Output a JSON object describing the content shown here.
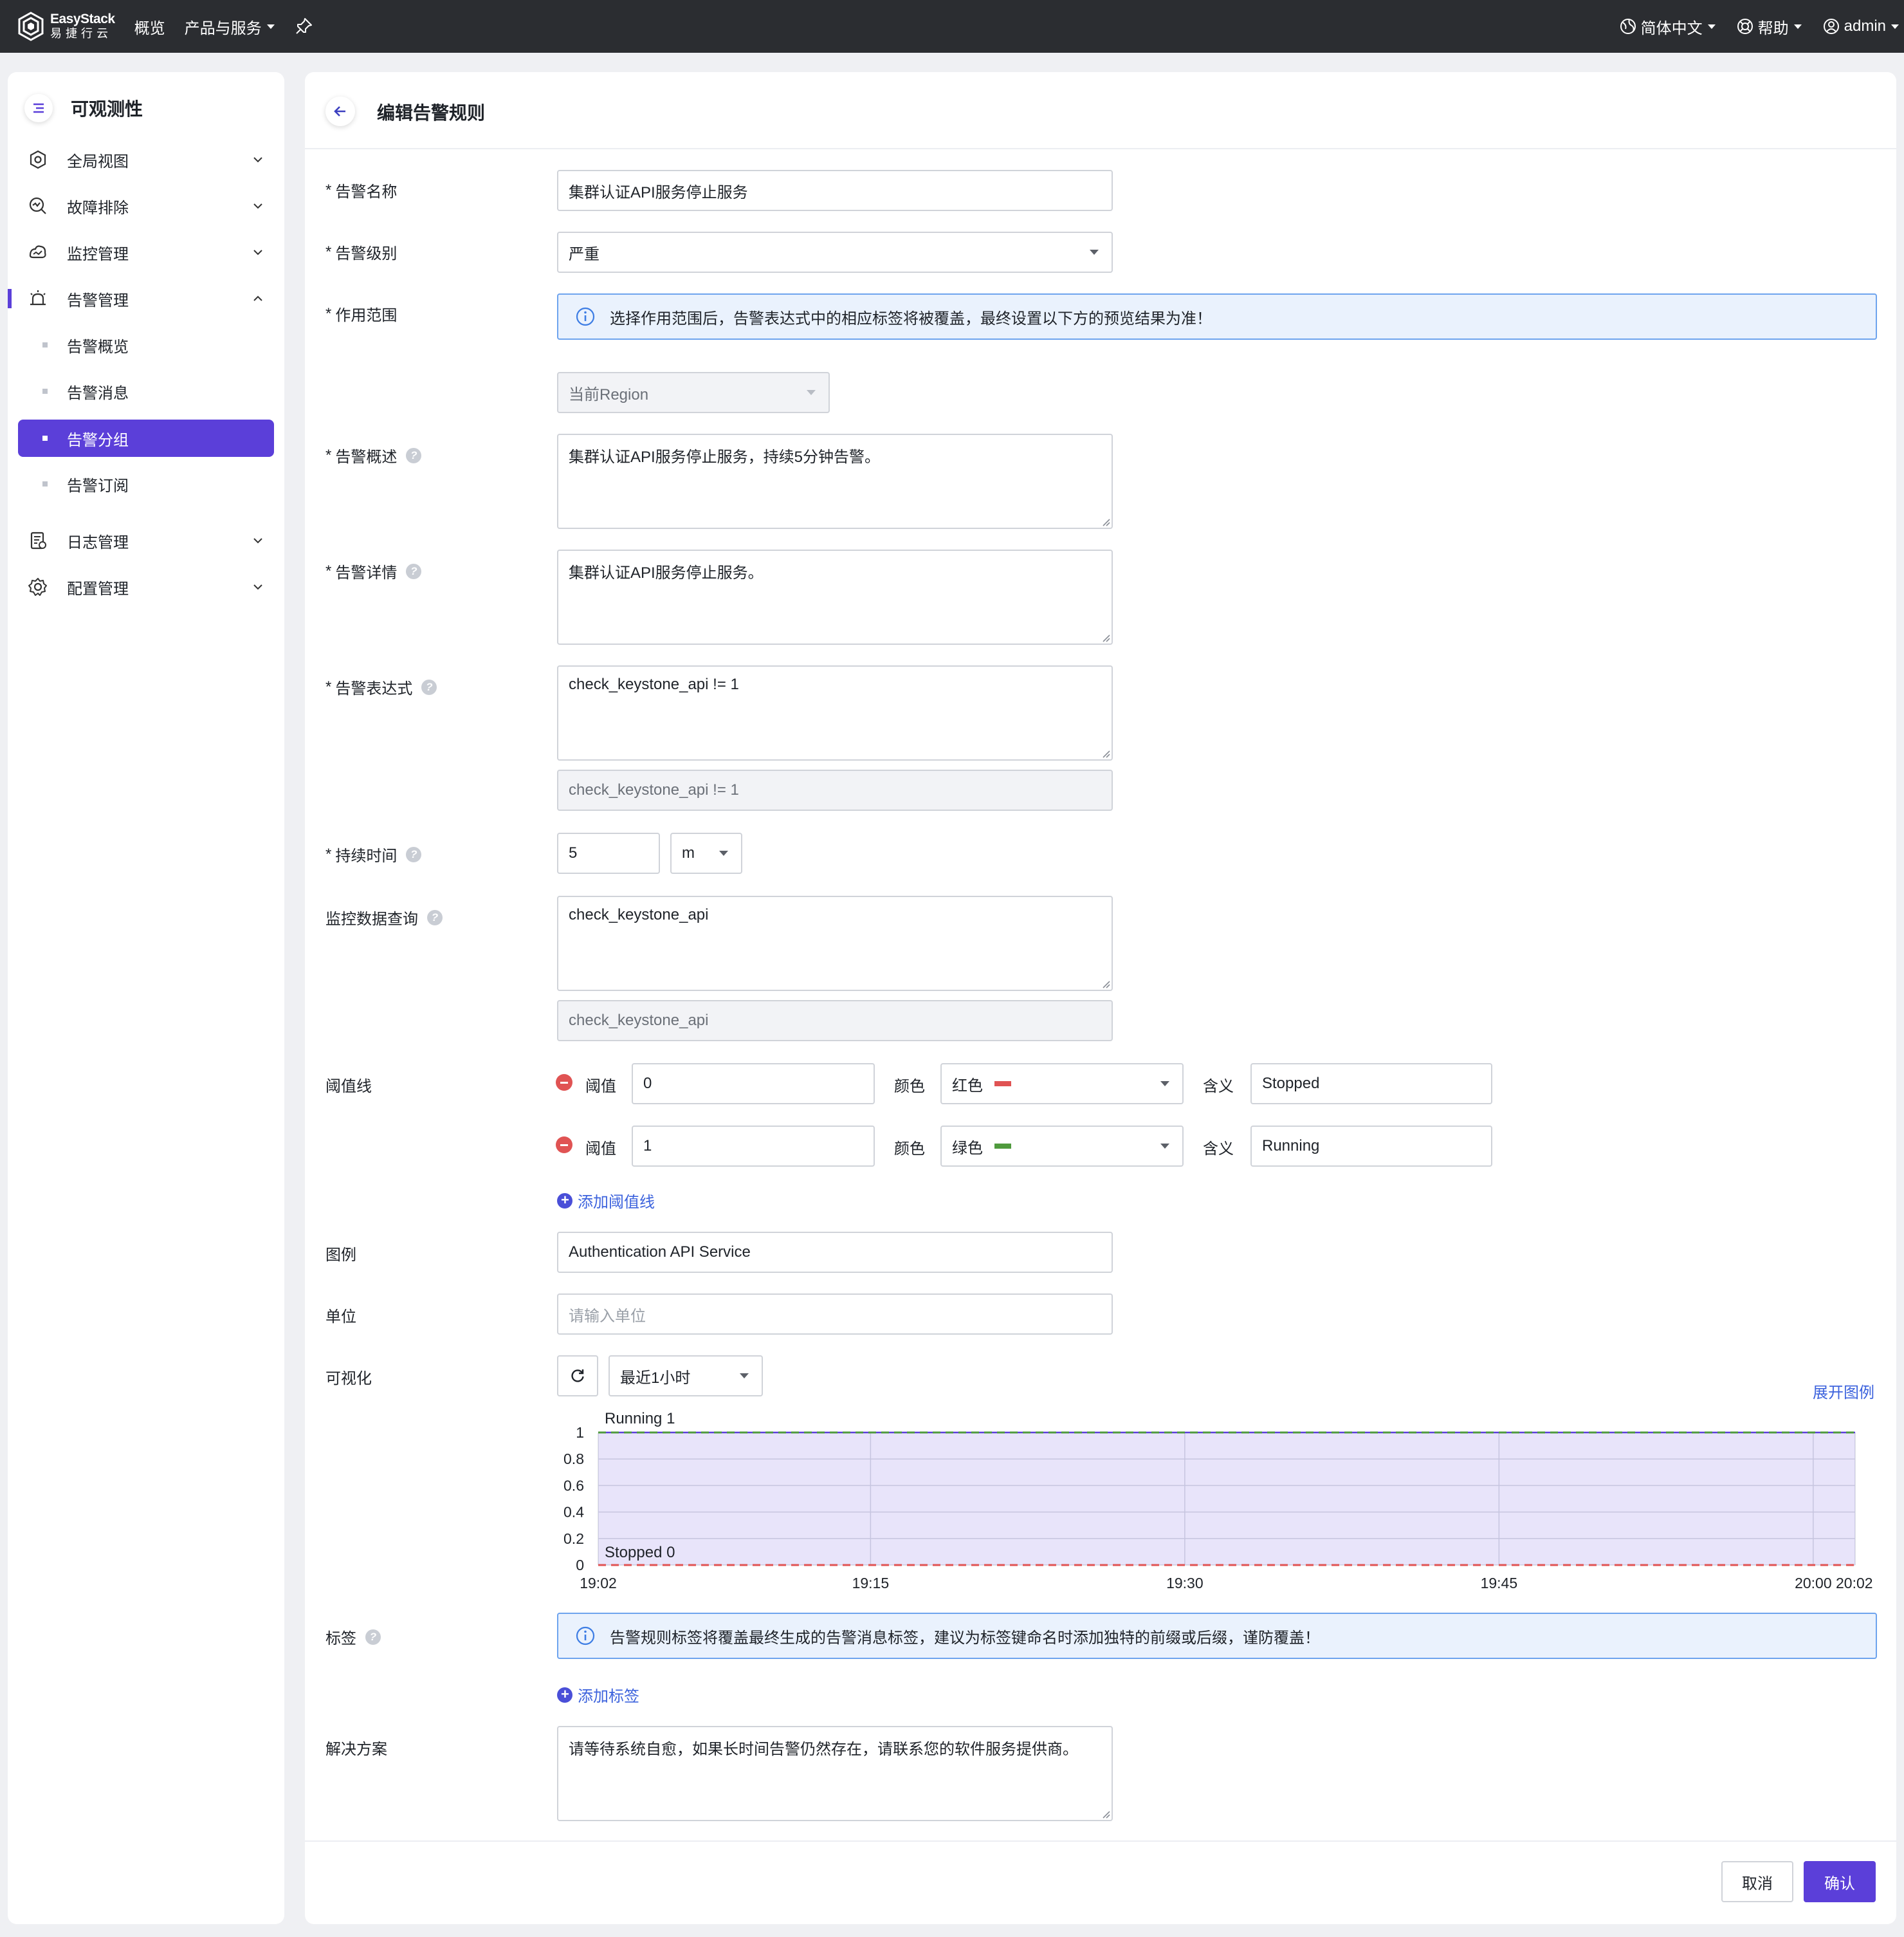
{
  "topbar": {
    "brand": "EasyStack",
    "brand_sub": "易捷行云",
    "nav": [
      "概览",
      "产品与服务"
    ],
    "language": "简体中文",
    "help": "帮助",
    "user": "admin"
  },
  "sidebar": {
    "title": "可观测性",
    "items": [
      {
        "label": "全局视图",
        "icon": "dashboard-icon"
      },
      {
        "label": "故障排除",
        "icon": "troubleshoot-icon"
      },
      {
        "label": "监控管理",
        "icon": "monitor-icon"
      },
      {
        "label": "告警管理",
        "icon": "alarm-icon"
      },
      {
        "label": "日志管理",
        "icon": "log-icon"
      },
      {
        "label": "配置管理",
        "icon": "gear-icon"
      }
    ],
    "alarm_sub": [
      "告警概览",
      "告警消息",
      "告警分组",
      "告警订阅"
    ],
    "active_sub": "告警分组"
  },
  "page": {
    "title": "编辑告警规则"
  },
  "form": {
    "name_label": "告警名称",
    "name_value": "集群认证API服务停止服务",
    "level_label": "告警级别",
    "level_value": "严重",
    "scope_label": "作用范围",
    "scope_alert": "选择作用范围后，告警表达式中的相应标签将被覆盖，最终设置以下方的预览结果为准！",
    "scope_value": "当前Region",
    "summary_label": "告警概述",
    "summary_value": "集群认证API服务停止服务，持续5分钟告警。",
    "detail_label": "告警详情",
    "detail_value": "集群认证API服务停止服务。",
    "expr_label": "告警表达式",
    "expr_value": "check_keystone_api != 1",
    "expr_preview": "check_keystone_api != 1",
    "duration_label": "持续时间",
    "duration_value": "5",
    "duration_unit": "m",
    "query_label": "监控数据查询",
    "query_value": "check_keystone_api",
    "query_preview": "check_keystone_api",
    "threshold_label": "阈值线",
    "threshold_field_label": "阈值",
    "color_field_label": "颜色",
    "meaning_field_label": "含义",
    "thresholds": [
      {
        "value": "0",
        "color": "红色",
        "swatch": "#e05353",
        "meaning": "Stopped"
      },
      {
        "value": "1",
        "color": "绿色",
        "swatch": "#4f9a3d",
        "meaning": "Running"
      }
    ],
    "add_threshold": "添加阈值线",
    "legend_label": "图例",
    "legend_value": "Authentication API Service",
    "unit_label": "单位",
    "unit_placeholder": "请输入单位",
    "viz_label": "可视化",
    "time_range": "最近1小时",
    "expand_legend": "展开图例",
    "tags_label": "标签",
    "tags_alert": "告警规则标签将覆盖最终生成的告警消息标签，建议为标签键命名时添加独特的前缀或后缀，谨防覆盖！",
    "add_tag": "添加标签",
    "solution_label": "解决方案",
    "solution_value": "请等待系统自愈，如果长时间告警仍然存在，请联系您的软件服务提供商。"
  },
  "actions": {
    "cancel": "取消",
    "confirm": "确认"
  },
  "chart_data": {
    "type": "area",
    "x_ticks": [
      "19:02",
      "19:15",
      "19:30",
      "19:45",
      "20:00",
      "20:02"
    ],
    "x_tick_minutes": [
      0,
      13,
      28,
      43,
      58,
      60
    ],
    "y_ticks": [
      0,
      0.2,
      0.4,
      0.6,
      0.8,
      1
    ],
    "ylim": [
      0,
      1
    ],
    "series": [
      {
        "name": "Authentication API Service",
        "values": [
          1,
          1,
          1,
          1,
          1,
          1
        ],
        "color": "#5b3fd9"
      }
    ],
    "threshold_lines": [
      {
        "value": 1,
        "label": "Running 1",
        "color": "#4f9a3d"
      },
      {
        "value": 0,
        "label": "Stopped 0",
        "color": "#e05353"
      }
    ],
    "grid": true
  }
}
